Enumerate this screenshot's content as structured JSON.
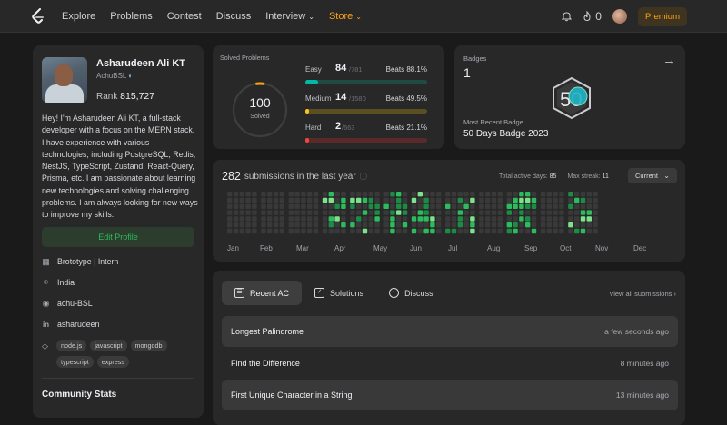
{
  "nav": {
    "links": [
      "Explore",
      "Problems",
      "Contest",
      "Discuss",
      "Interview",
      "Store"
    ],
    "streak": "0",
    "premium": "Premium"
  },
  "profile": {
    "name": "Asharudeen Ali KT",
    "username": "AchuBSL",
    "rank_label": "Rank",
    "rank": "815,727",
    "bio": "Hey! I'm Asharudeen Ali KT, a full-stack developer with a focus on the MERN stack. I have experience with various technologies, including PostgreSQL, Redis, NestJS, TypeScript, Zustand, React-Query, Prisma, etc. I am passionate about learning new technologies and solving challenging problems. I am always looking for new ways to improve my skills.",
    "edit_label": "Edit Profile",
    "company": "Brototype | Intern",
    "location": "India",
    "github": "achu-BSL",
    "linkedin": "asharudeen",
    "skills": [
      "node.js",
      "javascript",
      "mongodb",
      "typescript",
      "express"
    ],
    "community_title": "Community Stats"
  },
  "solved": {
    "title": "Solved Problems",
    "total": "100",
    "total_label": "Solved",
    "difficulties": [
      {
        "label": "Easy",
        "count": "84",
        "total": "/781",
        "beats": "88.1%",
        "fraction": 0.1076,
        "color": "#00b8a3",
        "track": "#1f4b43"
      },
      {
        "label": "Medium",
        "count": "14",
        "total": "/1580",
        "beats": "49.5%",
        "fraction": 0.0089,
        "color": "#ffc01e",
        "track": "#5a4f22"
      },
      {
        "label": "Hard",
        "count": "2",
        "total": "/663",
        "beats": "21.1%",
        "fraction": 0.003,
        "color": "#ef4743",
        "track": "#5a2a2a"
      }
    ],
    "beats_label": "Beats"
  },
  "badges": {
    "title": "Badges",
    "count": "1",
    "recent_label": "Most Recent Badge",
    "recent_name": "50 Days Badge 2023",
    "badge_text": "50"
  },
  "submissions": {
    "count": "282",
    "label": "submissions in the last year",
    "active_label": "Total active days:",
    "active_days": "85",
    "streak_label": "Max streak:",
    "max_streak": "11",
    "select": "Current",
    "months": [
      "Jan",
      "Feb",
      "Mar",
      "Apr",
      "May",
      "Jun",
      "Jul",
      "Aug",
      "Sep",
      "Oct",
      "Nov",
      "Dec"
    ]
  },
  "recent": {
    "tabs": [
      "Recent AC",
      "Solutions",
      "Discuss"
    ],
    "view_all": "View all submissions",
    "items": [
      {
        "title": "Longest Palindrome",
        "time": "a few seconds ago"
      },
      {
        "title": "Find the Difference",
        "time": "8 minutes ago"
      },
      {
        "title": "First Unique Character in a String",
        "time": "13 minutes ago"
      }
    ]
  }
}
